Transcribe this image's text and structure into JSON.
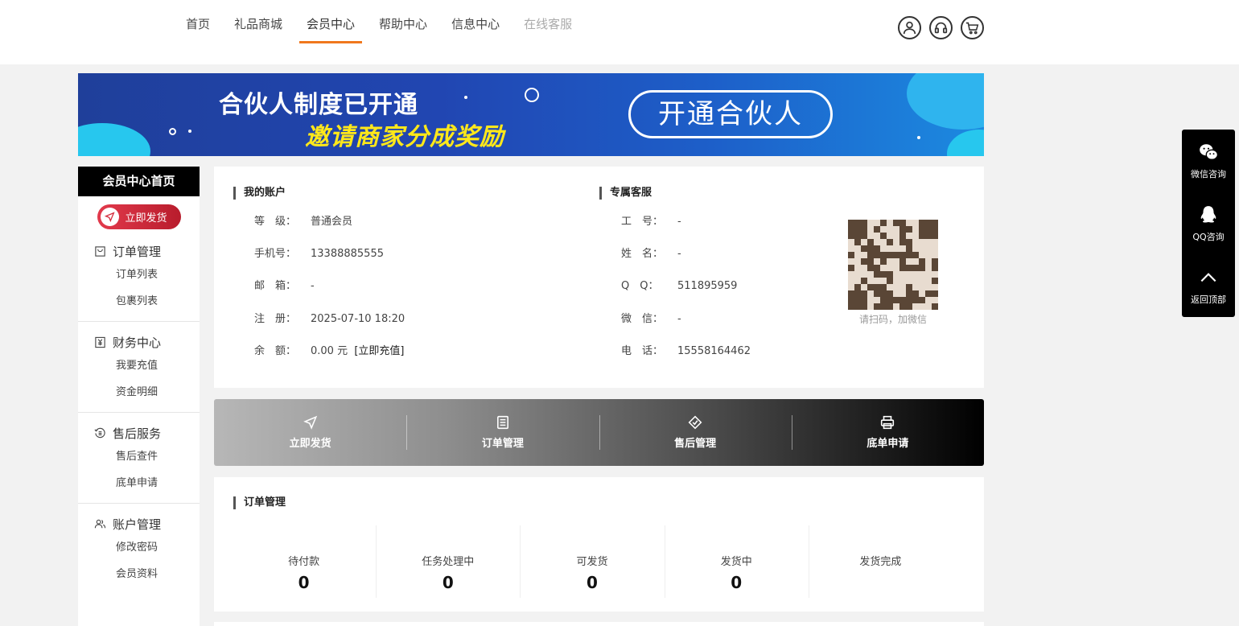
{
  "nav": {
    "items": [
      "首页",
      "礼品商城",
      "会员中心",
      "帮助中心",
      "信息中心",
      "在线客服"
    ],
    "active_index": 2,
    "icons": [
      "user-icon",
      "headset-icon",
      "cart-icon"
    ]
  },
  "banner": {
    "line1": "合伙人制度已开通",
    "line2": "邀请商家分成奖励",
    "cta": "开通合伙人"
  },
  "sidebar": {
    "header": "会员中心首页",
    "ship_button": "立即发货",
    "groups": [
      {
        "title": "订单管理",
        "icon": "bag-icon",
        "items": [
          "订单列表",
          "包裹列表"
        ]
      },
      {
        "title": "财务中心",
        "icon": "yuan-icon",
        "items": [
          "我要充值",
          "资金明细"
        ]
      },
      {
        "title": "售后服务",
        "icon": "service-icon",
        "items": [
          "售后查件",
          "底单申请"
        ]
      },
      {
        "title": "账户管理",
        "icon": "users-icon",
        "items": [
          "修改密码",
          "会员资料"
        ]
      }
    ]
  },
  "account": {
    "title": "我的账户",
    "rows": [
      {
        "label": "等　级：",
        "value": "普通会员"
      },
      {
        "label": "手机号：",
        "value": "13388885555"
      },
      {
        "label": "邮　箱：",
        "value": "-"
      },
      {
        "label": "注　册：",
        "value": "2025-07-10 18:20"
      },
      {
        "label": "余　额：",
        "value": "0.00 元"
      }
    ],
    "recharge_link": "[立即充值]"
  },
  "service": {
    "title": "专属客服",
    "rows": [
      {
        "label": "工　号：",
        "value": "-"
      },
      {
        "label": "姓　名：",
        "value": "-"
      },
      {
        "label": "Q　Q：",
        "value": "511895959"
      },
      {
        "label": "微　信：",
        "value": "-"
      },
      {
        "label": "电　话：",
        "value": "15558164462"
      }
    ],
    "qr_caption": "请扫码，加微信"
  },
  "actions": [
    "立即发货",
    "订单管理",
    "售后管理",
    "底单申请"
  ],
  "orders": {
    "title": "订单管理",
    "stats": [
      {
        "label": "待付款",
        "value": "0"
      },
      {
        "label": "任务处理中",
        "value": "0"
      },
      {
        "label": "可发货",
        "value": "0"
      },
      {
        "label": "发货中",
        "value": "0"
      },
      {
        "label": "发货完成",
        "value": ""
      }
    ]
  },
  "float_bar": [
    "微信咨询",
    "QQ咨询",
    "返回顶部"
  ],
  "colors": {
    "accent": "#f0781e",
    "ship_button": "#d42a3c",
    "banner_yellow": "#ffe81a"
  }
}
